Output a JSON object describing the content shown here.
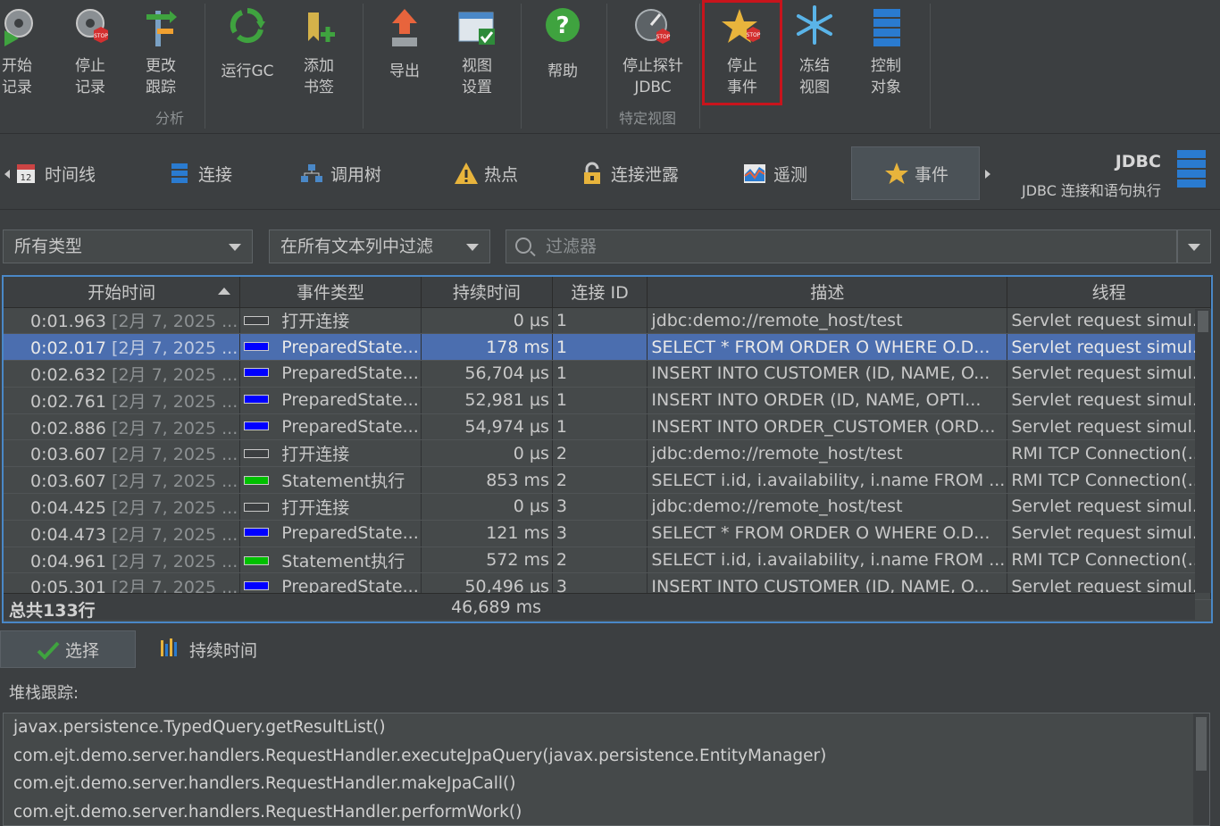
{
  "toolbar": {
    "buttons": [
      {
        "label": "开始\n记录",
        "icon": "record-start-icon"
      },
      {
        "label": "停止\n记录",
        "icon": "record-stop-icon"
      },
      {
        "label": "更改\n跟踪",
        "icon": "change-tracking-icon"
      },
      {
        "label": "运行GC",
        "icon": "run-gc-icon"
      },
      {
        "label": "添加\n书签",
        "icon": "add-bookmark-icon"
      },
      {
        "label": "导出",
        "icon": "export-icon"
      },
      {
        "label": "视图\n设置",
        "icon": "view-settings-icon"
      },
      {
        "label": "帮助",
        "icon": "help-icon"
      },
      {
        "label": "停止探针\nJDBC",
        "icon": "stop-probe-icon"
      },
      {
        "label": "停止\n事件",
        "icon": "stop-events-icon"
      },
      {
        "label": "冻结\n视图",
        "icon": "freeze-view-icon"
      },
      {
        "label": "控制\n对象",
        "icon": "control-objects-icon"
      }
    ],
    "groups": {
      "analysis": "分析",
      "view_specific": "特定视图"
    }
  },
  "tabs": [
    {
      "label": "时间线",
      "icon": "calendar-icon"
    },
    {
      "label": "连接",
      "icon": "connection-icon"
    },
    {
      "label": "调用树",
      "icon": "call-tree-icon"
    },
    {
      "label": "热点",
      "icon": "warning-icon"
    },
    {
      "label": "连接泄露",
      "icon": "lock-icon"
    },
    {
      "label": "遥测",
      "icon": "telemetry-icon"
    },
    {
      "label": "事件",
      "icon": "star-icon",
      "active": true
    }
  ],
  "probe": {
    "title": "JDBC",
    "subtitle": "JDBC 连接和语句执行"
  },
  "filters": {
    "type_combo": "所有类型",
    "column_combo": "在所有文本列中过滤",
    "search_placeholder": "过滤器"
  },
  "table": {
    "columns": [
      "开始时间",
      "事件类型",
      "持续时间",
      "连接 ID",
      "描述",
      "线程"
    ],
    "rows": [
      {
        "time": "0:01.963",
        "date": "[2月 7, 2025 ...",
        "type": "打开连接",
        "color": "#3c3f41",
        "duration": "0 µs",
        "conn": "1",
        "desc": "jdbc:demo://remote_host/test",
        "thread": "Servlet request simul..."
      },
      {
        "time": "0:02.017",
        "date": "[2月 7, 2025 ...",
        "type": "PreparedState...",
        "color": "#0000ff",
        "duration": "178 ms",
        "conn": "1",
        "desc": "SELECT * FROM ORDER O WHERE O.D...",
        "thread": "Servlet request simul..."
      },
      {
        "time": "0:02.632",
        "date": "[2月 7, 2025 ...",
        "type": "PreparedState...",
        "color": "#0000ff",
        "duration": "56,704 µs",
        "conn": "1",
        "desc": "INSERT INTO CUSTOMER (ID, NAME, O...",
        "thread": "Servlet request simul..."
      },
      {
        "time": "0:02.761",
        "date": "[2月 7, 2025 ...",
        "type": "PreparedState...",
        "color": "#0000ff",
        "duration": "52,981 µs",
        "conn": "1",
        "desc": "INSERT INTO ORDER (ID, NAME, OPTI...",
        "thread": "Servlet request simul..."
      },
      {
        "time": "0:02.886",
        "date": "[2月 7, 2025 ...",
        "type": "PreparedState...",
        "color": "#0000ff",
        "duration": "54,974 µs",
        "conn": "1",
        "desc": "INSERT INTO ORDER_CUSTOMER (ORD...",
        "thread": "Servlet request simul..."
      },
      {
        "time": "0:03.607",
        "date": "[2月 7, 2025 ...",
        "type": "打开连接",
        "color": "#3c3f41",
        "duration": "0 µs",
        "conn": "2",
        "desc": "jdbc:demo://remote_host/test",
        "thread": "RMI TCP Connection(..."
      },
      {
        "time": "0:03.607",
        "date": "[2月 7, 2025 ...",
        "type": "Statement执行",
        "color": "#00c000",
        "duration": "853 ms",
        "conn": "2",
        "desc": "SELECT i.id, i.availability, i.name FROM ...",
        "thread": "RMI TCP Connection(..."
      },
      {
        "time": "0:04.425",
        "date": "[2月 7, 2025 ...",
        "type": "打开连接",
        "color": "#3c3f41",
        "duration": "0 µs",
        "conn": "3",
        "desc": "jdbc:demo://remote_host/test",
        "thread": "Servlet request simul..."
      },
      {
        "time": "0:04.473",
        "date": "[2月 7, 2025 ...",
        "type": "PreparedState...",
        "color": "#0000ff",
        "duration": "121 ms",
        "conn": "3",
        "desc": "SELECT * FROM ORDER O WHERE O.D...",
        "thread": "Servlet request simul..."
      },
      {
        "time": "0:04.961",
        "date": "[2月 7, 2025 ...",
        "type": "Statement执行",
        "color": "#00c000",
        "duration": "572 ms",
        "conn": "2",
        "desc": "SELECT i.id, i.availability, i.name FROM ...",
        "thread": "RMI TCP Connection(..."
      },
      {
        "time": "0:05.301",
        "date": "[2月 7, 2025 ...",
        "type": "PreparedState...",
        "color": "#0000ff",
        "duration": "50,496 µs",
        "conn": "3",
        "desc": "INSERT INTO CUSTOMER (ID, NAME, O...",
        "thread": "Servlet request simul..."
      }
    ],
    "total_label": "总共133行",
    "total_duration": "46,689 ms"
  },
  "bottom": {
    "select_label": "选择",
    "duration_label": "持续时间",
    "stack_label": "堆栈跟踪:",
    "stack": [
      "javax.persistence.TypedQuery.getResultList()",
      "com.ejt.demo.server.handlers.RequestHandler.executeJpaQuery(javax.persistence.EntityManager)",
      "com.ejt.demo.server.handlers.RequestHandler.makeJpaCall()",
      "com.ejt.demo.server.handlers.RequestHandler.performWork()"
    ]
  }
}
